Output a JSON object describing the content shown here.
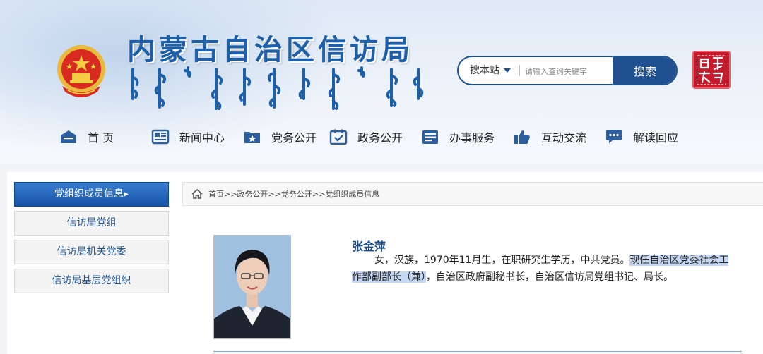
{
  "header": {
    "site_title": "内蒙古自治区信访局",
    "search": {
      "scope_label": "搜本站",
      "placeholder": "请输入查询关键字",
      "button_label": "搜索"
    }
  },
  "nav": [
    {
      "label": "首 页",
      "icon": "home-icon"
    },
    {
      "label": "新闻中心",
      "icon": "news-icon"
    },
    {
      "label": "党务公开",
      "icon": "party-star-icon"
    },
    {
      "label": "政务公开",
      "icon": "checklist-icon"
    },
    {
      "label": "办事服务",
      "icon": "service-icon"
    },
    {
      "label": "互动交流",
      "icon": "thumbs-up-icon"
    },
    {
      "label": "解读回应",
      "icon": "chat-bubble-icon"
    }
  ],
  "sidebar": {
    "items": [
      {
        "label": "党组织成员信息▸",
        "active": true
      },
      {
        "label": "信访局党组",
        "active": false
      },
      {
        "label": "信访局机关党委",
        "active": false
      },
      {
        "label": "信访局基层党组织",
        "active": false
      }
    ]
  },
  "breadcrumb": {
    "text": "首页>>政务公开>>党务公开>>党组织成员信息"
  },
  "profile": {
    "name": "张金萍",
    "bio_before": "女，汉族，1970年11月生，在职研究生学历，中共党员。",
    "bio_highlight": "现任自治区党委社会工作部副部长（兼）",
    "bio_after": "，自治区政府副秘书长，自治区信访局党组书记、局长。"
  },
  "colors": {
    "brand_blue": "#1d5fa8",
    "nav_dark": "#1f4f8f",
    "sidebar_active": "#1553a7",
    "highlight": "#c5d7f3",
    "seal_red": "#c8192a"
  }
}
